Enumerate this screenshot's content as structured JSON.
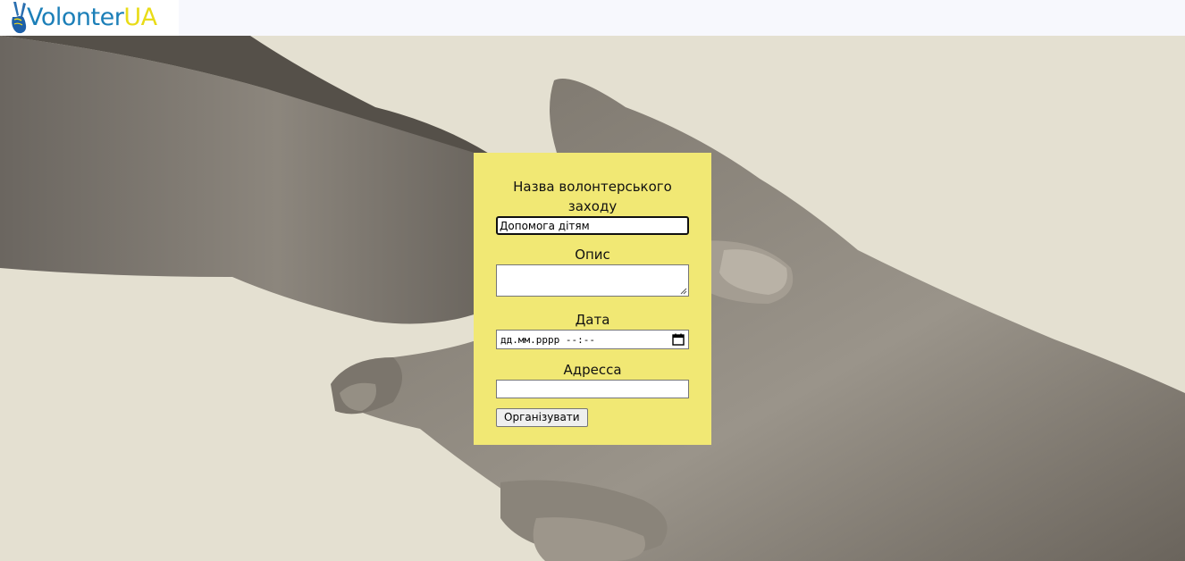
{
  "header": {
    "logo": {
      "brand_primary": "Volonter",
      "brand_accent": "UA",
      "icon": "victory-hand-icon",
      "colors": {
        "primary": "#1c7fb8",
        "accent": "#e9dc18"
      }
    }
  },
  "hero": {
    "image": "handshake-photo"
  },
  "form": {
    "title_label": "Назва волонтерського заходу",
    "title_value": "Допомога дітям",
    "description_label": "Опис",
    "description_value": "",
    "date_label": "Дата",
    "date_placeholder": "дд.мм.рррр --:--",
    "date_icon": "calendar-icon",
    "address_label": "Адресса",
    "address_value": "",
    "submit_label": "Організувати",
    "background": "#f1e874"
  }
}
